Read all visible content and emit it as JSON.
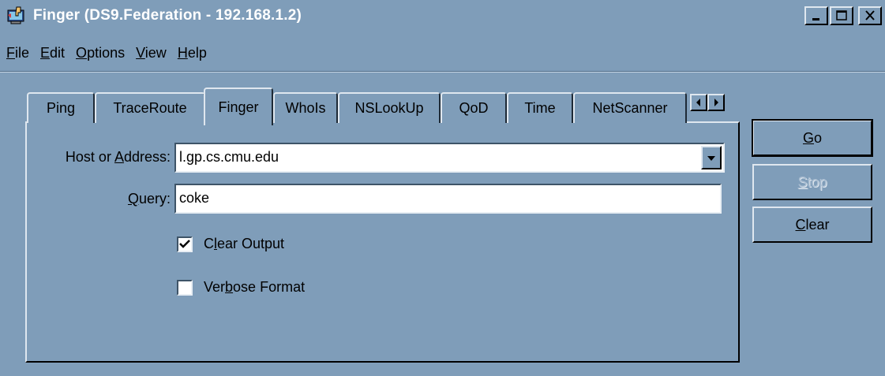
{
  "window": {
    "title": "Finger (DS9.Federation - 192.168.1.2)"
  },
  "menu": [
    {
      "pre": "",
      "key": "F",
      "post": "ile"
    },
    {
      "pre": "",
      "key": "E",
      "post": "dit"
    },
    {
      "pre": "",
      "key": "O",
      "post": "ptions"
    },
    {
      "pre": "",
      "key": "V",
      "post": "iew"
    },
    {
      "pre": "",
      "key": "H",
      "post": "elp"
    }
  ],
  "tabs": [
    "Ping",
    "TraceRoute",
    "Finger",
    "WhoIs",
    "NSLookUp",
    "QoD",
    "Time",
    "NetScanner"
  ],
  "active_tab": "Finger",
  "form": {
    "host_label": {
      "pre": "Host or ",
      "key": "A",
      "post": "ddress:"
    },
    "host_value": "l.gp.cs.cmu.edu",
    "query_label": {
      "pre": "",
      "key": "Q",
      "post": "uery:"
    },
    "query_value": "coke",
    "clear_output": {
      "pre": "C",
      "key": "l",
      "post": "ear Output",
      "checked": true
    },
    "verbose_format": {
      "pre": "Ver",
      "key": "b",
      "post": "ose Format",
      "checked": false
    }
  },
  "buttons": {
    "go": {
      "key": "G",
      "post": "o"
    },
    "stop": {
      "key": "S",
      "post": "top",
      "enabled": false
    },
    "clear": {
      "key": "C",
      "post": "lear"
    }
  },
  "colors": {
    "face": "#7f9db9",
    "highlight": "#dfe7ef",
    "shadow": "#000000",
    "title_text": "#ffffff"
  }
}
